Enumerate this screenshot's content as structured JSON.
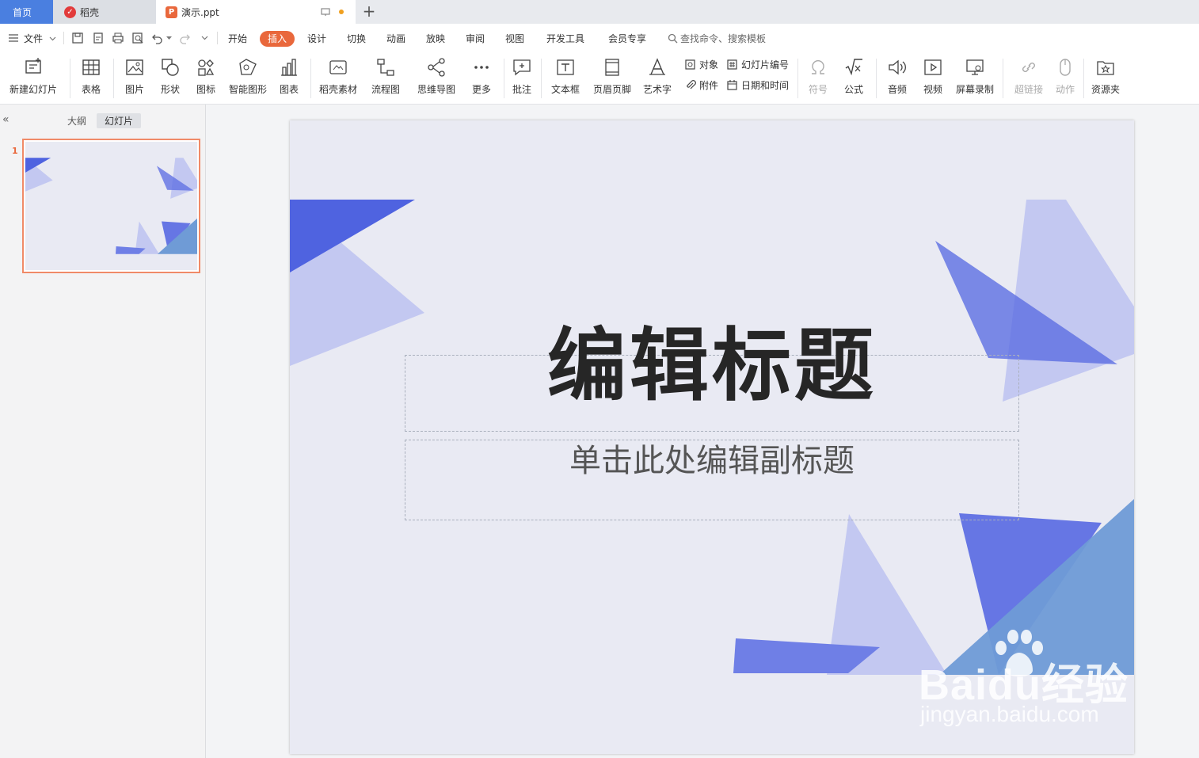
{
  "tabs": {
    "home": "首页",
    "daoke": "稻壳",
    "document": "演示.ppt"
  },
  "menu": {
    "file": "文件",
    "items": [
      "开始",
      "插入",
      "设计",
      "切换",
      "动画",
      "放映",
      "审阅",
      "视图",
      "开发工具",
      "会员专享"
    ],
    "active": "插入",
    "search_placeholder": "查找命令、搜索模板"
  },
  "ribbon": {
    "new_slide": "新建幻灯片",
    "table": "表格",
    "picture": "图片",
    "shape": "形状",
    "icon": "图标",
    "smart_graphic": "智能图形",
    "chart": "图表",
    "daoke_material": "稻壳素材",
    "flowchart": "流程图",
    "mindmap": "思维导图",
    "more": "更多",
    "comment": "批注",
    "textbox": "文本框",
    "header_footer": "页眉页脚",
    "wordart": "艺术字",
    "object": "对象",
    "attachment": "附件",
    "slide_number": "幻灯片编号",
    "date_time": "日期和时间",
    "symbol": "符号",
    "formula": "公式",
    "audio": "音频",
    "video": "视频",
    "screen_record": "屏幕录制",
    "hyperlink": "超链接",
    "action": "动作",
    "resource_folder": "资源夹"
  },
  "left_panel": {
    "outline": "大纲",
    "slides": "幻灯片",
    "slide_number": "1"
  },
  "slide": {
    "title": "编辑标题",
    "subtitle": "单击此处编辑副标题"
  },
  "watermark": {
    "brand": "Baidu经验",
    "url": "jingyan.baidu.com"
  },
  "colors": {
    "accent_orange": "#e9683c",
    "home_tab_blue": "#4a7fe0",
    "slide_bg": "#e9eaf3",
    "triangle_dark": "#4f63e0",
    "triangle_light": "#c3c8f1",
    "triangle_steel": "#6f9bd6"
  }
}
